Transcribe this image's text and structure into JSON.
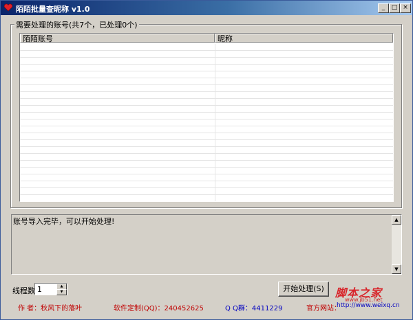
{
  "window": {
    "title": "陌陌批量查昵称 v1.0",
    "controls": [
      "_",
      "□",
      "×"
    ]
  },
  "accounts": {
    "group_label": "需要处理的账号(共7个，已处理0个)",
    "columns": [
      "陌陌账号",
      "昵称"
    ]
  },
  "log": {
    "text": "账号导入完毕，可以开始处理!"
  },
  "threads": {
    "label": "线程数",
    "value": "1"
  },
  "start_button": {
    "label": "开始处理(S)"
  },
  "footer": {
    "author": "作 者：秋风下的落叶",
    "custom": "软件定制(QQ)：240452625",
    "qq_group": "Q Q群：4411229",
    "website_label": "官方网站：",
    "website_url": "http://www.weixq.cn"
  },
  "watermark": {
    "main": "脚本之家",
    "sub": "www.jb51.net"
  },
  "colors": {
    "titlebar_start": "#0a246a",
    "titlebar_end": "#a6caf0",
    "face": "#d4d0c8",
    "footer_red": "#c00000",
    "footer_blue": "#0000c0"
  }
}
